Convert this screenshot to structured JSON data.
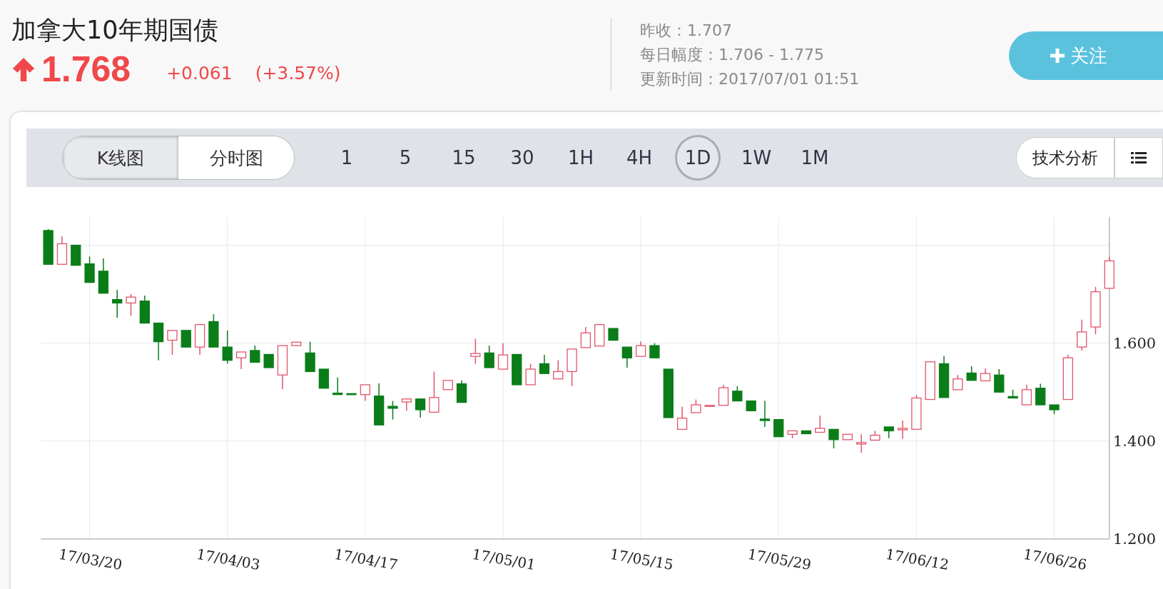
{
  "header": {
    "title": "加拿大10年期国债",
    "price": "1.768",
    "change": "+0.061",
    "change_pct": "(+3.57%)",
    "stats": [
      {
        "label": "昨收：",
        "value": "1.707"
      },
      {
        "label": "每日幅度：",
        "value": "1.706 - 1.775"
      },
      {
        "label": "更新时间：",
        "value": "2017/07/01 01:51"
      }
    ],
    "follow_button": "关注"
  },
  "toolbar": {
    "views": [
      {
        "label": "K线图",
        "selected": true
      },
      {
        "label": "分时图",
        "selected": false
      }
    ],
    "intervals": [
      {
        "label": "1",
        "selected": false
      },
      {
        "label": "5",
        "selected": false
      },
      {
        "label": "15",
        "selected": false
      },
      {
        "label": "30",
        "selected": false
      },
      {
        "label": "1H",
        "selected": false
      },
      {
        "label": "4H",
        "selected": false
      },
      {
        "label": "1D",
        "selected": true
      },
      {
        "label": "1W",
        "selected": false
      },
      {
        "label": "1M",
        "selected": false
      }
    ],
    "analysis_button": "技术分析"
  },
  "chart": {
    "chart_data": {
      "type": "candlestick",
      "grid": true,
      "ylim": [
        1.2,
        1.858
      ],
      "yticks": [
        {
          "value": 1.2,
          "label": "1.200"
        },
        {
          "value": 1.4,
          "label": "1.400"
        },
        {
          "value": 1.6,
          "label": "1.600"
        }
      ],
      "categories": [
        null,
        null,
        null,
        "17/03/20",
        null,
        null,
        null,
        null,
        null,
        null,
        null,
        null,
        null,
        "17/04/03",
        null,
        null,
        null,
        null,
        null,
        null,
        null,
        null,
        null,
        "17/04/17",
        null,
        null,
        null,
        null,
        null,
        null,
        null,
        null,
        null,
        "17/05/01",
        null,
        null,
        null,
        null,
        null,
        null,
        null,
        null,
        null,
        "17/05/15",
        null,
        null,
        null,
        null,
        null,
        null,
        null,
        null,
        null,
        "17/05/29",
        null,
        null,
        null,
        null,
        null,
        null,
        null,
        null,
        null,
        "17/06/12",
        null,
        null,
        null,
        null,
        null,
        null,
        null,
        null,
        null,
        "17/06/26",
        null,
        null,
        null,
        null
      ],
      "ohlc": [
        [
          1.83,
          1.833,
          1.761,
          1.761
        ],
        [
          1.761,
          1.818,
          1.761,
          1.803
        ],
        [
          1.8,
          1.8,
          1.759,
          1.759
        ],
        [
          1.762,
          1.777,
          1.724,
          1.724
        ],
        [
          1.747,
          1.773,
          1.702,
          1.702
        ],
        [
          1.689,
          1.709,
          1.652,
          1.682
        ],
        [
          1.682,
          1.7,
          1.656,
          1.694
        ],
        [
          1.686,
          1.697,
          1.641,
          1.641
        ],
        [
          1.641,
          1.641,
          1.565,
          1.603
        ],
        [
          1.606,
          1.626,
          1.576,
          1.626
        ],
        [
          1.626,
          1.626,
          1.592,
          1.592
        ],
        [
          1.592,
          1.638,
          1.576,
          1.638
        ],
        [
          1.644,
          1.659,
          1.592,
          1.592
        ],
        [
          1.592,
          1.626,
          1.558,
          1.565
        ],
        [
          1.57,
          1.582,
          1.547,
          1.582
        ],
        [
          1.585,
          1.595,
          1.561,
          1.561
        ],
        [
          1.577,
          1.577,
          1.55,
          1.55
        ],
        [
          1.535,
          1.595,
          1.506,
          1.595
        ],
        [
          1.595,
          1.602,
          1.595,
          1.602
        ],
        [
          1.58,
          1.603,
          1.542,
          1.542
        ],
        [
          1.547,
          1.547,
          1.508,
          1.508
        ],
        [
          1.498,
          1.53,
          1.495,
          1.495
        ],
        [
          1.497,
          1.497,
          1.495,
          1.495
        ],
        [
          1.495,
          1.515,
          1.482,
          1.515
        ],
        [
          1.492,
          1.518,
          1.433,
          1.433
        ],
        [
          1.471,
          1.482,
          1.444,
          1.467
        ],
        [
          1.48,
          1.486,
          1.462,
          1.486
        ],
        [
          1.486,
          1.486,
          1.448,
          1.464
        ],
        [
          1.459,
          1.542,
          1.459,
          1.489
        ],
        [
          1.505,
          1.524,
          1.505,
          1.524
        ],
        [
          1.517,
          1.524,
          1.479,
          1.479
        ],
        [
          1.573,
          1.609,
          1.558,
          1.579
        ],
        [
          1.58,
          1.595,
          1.55,
          1.55
        ],
        [
          1.547,
          1.6,
          1.547,
          1.576
        ],
        [
          1.577,
          1.577,
          1.515,
          1.515
        ],
        [
          1.515,
          1.558,
          1.515,
          1.547
        ],
        [
          1.558,
          1.576,
          1.538,
          1.538
        ],
        [
          1.527,
          1.565,
          1.527,
          1.542
        ],
        [
          1.542,
          1.588,
          1.512,
          1.588
        ],
        [
          1.591,
          1.633,
          1.591,
          1.621
        ],
        [
          1.594,
          1.638,
          1.594,
          1.638
        ],
        [
          1.63,
          1.63,
          1.606,
          1.606
        ],
        [
          1.592,
          1.592,
          1.55,
          1.57
        ],
        [
          1.573,
          1.603,
          1.573,
          1.595
        ],
        [
          1.595,
          1.6,
          1.57,
          1.57
        ],
        [
          1.547,
          1.547,
          1.448,
          1.448
        ],
        [
          1.424,
          1.47,
          1.424,
          1.447
        ],
        [
          1.458,
          1.485,
          1.458,
          1.474
        ],
        [
          1.471,
          1.473,
          1.471,
          1.473
        ],
        [
          1.473,
          1.515,
          1.473,
          1.509
        ],
        [
          1.502,
          1.512,
          1.482,
          1.482
        ],
        [
          1.482,
          1.482,
          1.462,
          1.462
        ],
        [
          1.445,
          1.482,
          1.429,
          1.442
        ],
        [
          1.444,
          1.444,
          1.409,
          1.409
        ],
        [
          1.414,
          1.421,
          1.406,
          1.421
        ],
        [
          1.421,
          1.421,
          1.415,
          1.415
        ],
        [
          1.418,
          1.452,
          1.418,
          1.426
        ],
        [
          1.424,
          1.424,
          1.385,
          1.403
        ],
        [
          1.403,
          1.414,
          1.403,
          1.414
        ],
        [
          1.394,
          1.414,
          1.376,
          1.397
        ],
        [
          1.402,
          1.421,
          1.402,
          1.412
        ],
        [
          1.429,
          1.429,
          1.406,
          1.421
        ],
        [
          1.423,
          1.442,
          1.405,
          1.426
        ],
        [
          1.424,
          1.494,
          1.424,
          1.488
        ],
        [
          1.485,
          1.562,
          1.485,
          1.562
        ],
        [
          1.558,
          1.574,
          1.489,
          1.489
        ],
        [
          1.505,
          1.535,
          1.505,
          1.527
        ],
        [
          1.539,
          1.553,
          1.524,
          1.524
        ],
        [
          1.523,
          1.548,
          1.523,
          1.538
        ],
        [
          1.535,
          1.547,
          1.5,
          1.5
        ],
        [
          1.491,
          1.505,
          1.488,
          1.488
        ],
        [
          1.474,
          1.515,
          1.474,
          1.505
        ],
        [
          1.508,
          1.517,
          1.474,
          1.474
        ],
        [
          1.474,
          1.474,
          1.455,
          1.464
        ],
        [
          1.485,
          1.576,
          1.485,
          1.57
        ],
        [
          1.592,
          1.648,
          1.585,
          1.623
        ],
        [
          1.633,
          1.715,
          1.618,
          1.705
        ],
        [
          1.712,
          1.776,
          1.712,
          1.768
        ]
      ]
    }
  }
}
